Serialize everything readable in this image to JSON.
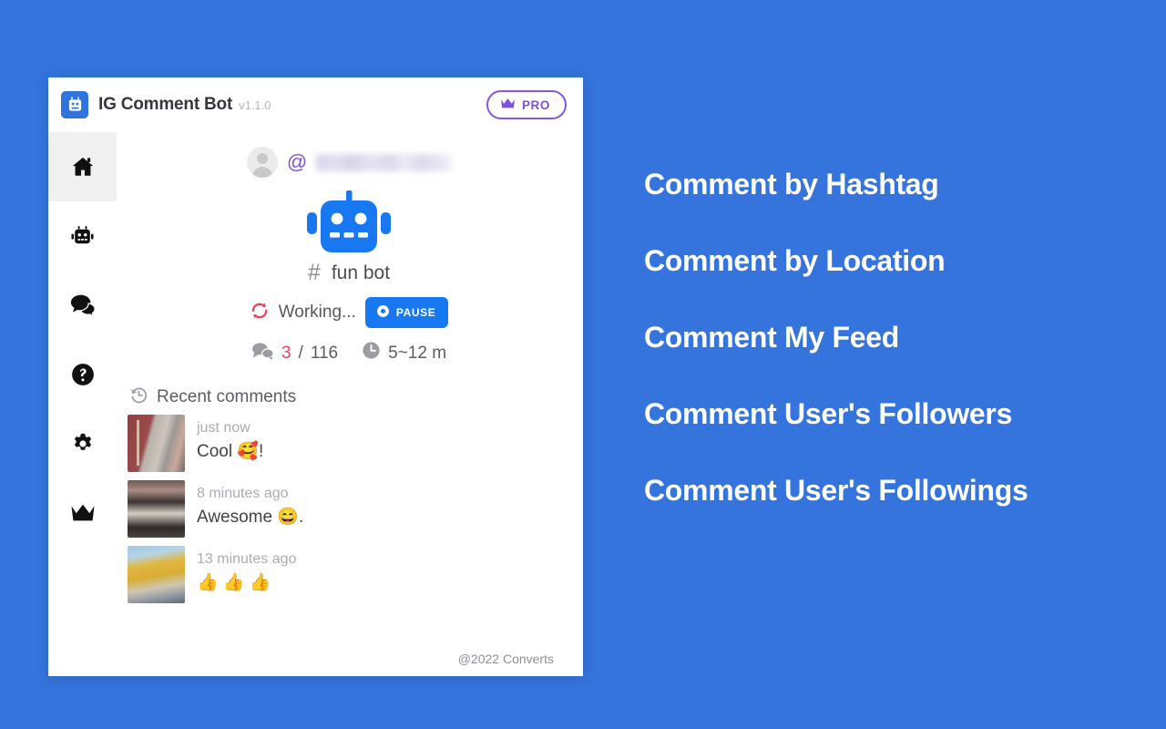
{
  "background_color": "#3474DC",
  "app": {
    "logo_icon": "robot-logo-icon",
    "title": "IG Comment Bot",
    "version": "v1.1.0",
    "pro_badge": {
      "icon": "crown-icon",
      "label": "PRO",
      "color": "#7b4fe0"
    }
  },
  "sidebar": {
    "items": [
      {
        "icon": "home-icon",
        "name": "sidebar-item-home",
        "active": true
      },
      {
        "icon": "robot-icon",
        "name": "sidebar-item-bot",
        "active": false
      },
      {
        "icon": "comments-icon",
        "name": "sidebar-item-comments",
        "active": false
      },
      {
        "icon": "help-icon",
        "name": "sidebar-item-help",
        "active": false
      },
      {
        "icon": "gear-icon",
        "name": "sidebar-item-settings",
        "active": false
      },
      {
        "icon": "crown-icon",
        "name": "sidebar-item-pro",
        "active": false
      }
    ]
  },
  "account": {
    "avatar_icon": "default-avatar-icon",
    "at_symbol": "@",
    "username": "",
    "username_blurred": true
  },
  "task": {
    "hero_icon": "robot-hero-icon",
    "hero_color": "#1878f2",
    "hash_symbol": "#",
    "target_name": "fun bot",
    "status_icon": "sync-icon",
    "status_icon_color": "#e8455f",
    "status_text": "Working...",
    "pause_button": {
      "icon": "pause-circle-icon",
      "label": "PAUSE",
      "color": "#1878f2"
    },
    "progress": {
      "icon": "comments-count-icon",
      "done": "3",
      "separator": "/",
      "total": "116",
      "done_color": "#e8455f"
    },
    "eta": {
      "icon": "clock-icon",
      "text": "5~12 m"
    }
  },
  "recent": {
    "icon": "history-icon",
    "title": "Recent comments",
    "comments": [
      {
        "thumb": "photo-thumbnail-1",
        "time": "just now",
        "text": "Cool 🥰!"
      },
      {
        "thumb": "photo-thumbnail-2",
        "time": "8 minutes ago",
        "text": "Awesome 😄."
      },
      {
        "thumb": "photo-thumbnail-3",
        "time": "13 minutes ago",
        "text": "👍 👍 👍"
      }
    ]
  },
  "footer": {
    "copyright": "@2022 Converts"
  },
  "features": {
    "items": [
      "Comment by Hashtag",
      "Comment by Location",
      "Comment My Feed",
      "Comment User's Followers",
      "Comment User's Followings"
    ]
  }
}
